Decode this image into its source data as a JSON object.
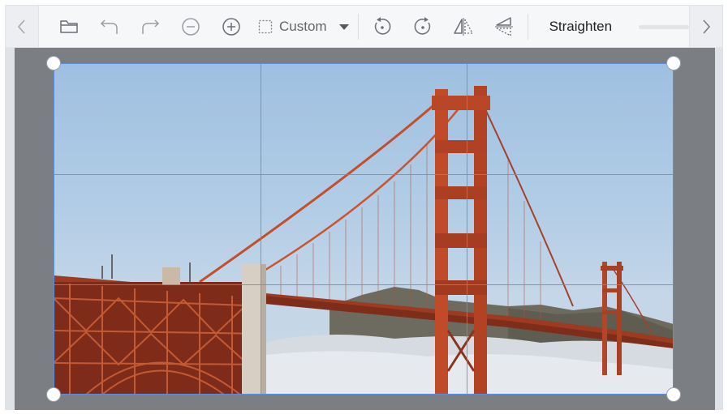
{
  "toolbar": {
    "aspect_label": "Custom",
    "straighten_label": "Straighten",
    "icons": [
      "chevron-left-icon",
      "folder-icon",
      "undo-icon",
      "redo-icon",
      "zoom-out-icon",
      "zoom-in-icon",
      "crop-selection-icon",
      "dropdown-arrow-icon",
      "rotate-left-icon",
      "rotate-right-icon",
      "flip-horizontal-icon",
      "flip-vertical-icon",
      "chevron-right-icon"
    ]
  },
  "colors": {
    "toolbar_bg": "#f6f7f9",
    "canvas_bg": "#7b7e82",
    "crop_accent": "#5b8ee0",
    "icon_color": "#6b6f75"
  }
}
